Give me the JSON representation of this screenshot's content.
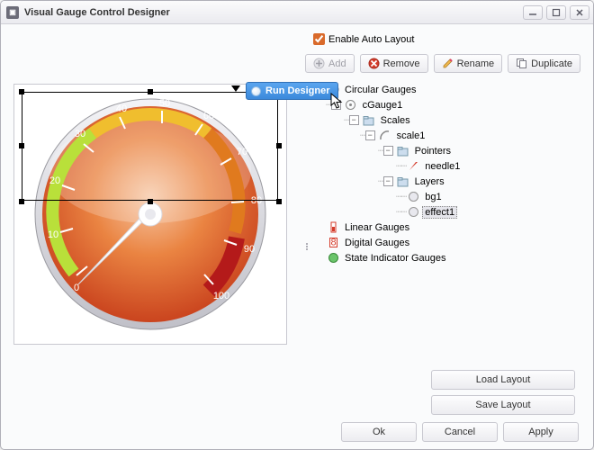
{
  "window": {
    "title": "Visual Gauge Control Designer",
    "minimize": "—",
    "maximize": "❐",
    "close": "✕"
  },
  "checkbox": {
    "label": "Enable Auto Layout",
    "checked": true
  },
  "toolbar": {
    "add": "Add",
    "remove": "Remove",
    "rename": "Rename",
    "duplicate": "Duplicate"
  },
  "context": {
    "run_designer": "Run Designer"
  },
  "tree": {
    "circular_gauges": "Circular Gauges",
    "cgauge1": "cGauge1",
    "scales": "Scales",
    "scale1": "scale1",
    "pointers": "Pointers",
    "needle1": "needle1",
    "layers": "Layers",
    "bg1": "bg1",
    "effect1": "effect1",
    "linear_gauges": "Linear Gauges",
    "digital_gauges": "Digital Gauges",
    "state_indicator_gauges": "State Indicator Gauges"
  },
  "layout_buttons": {
    "load": "Load Layout",
    "save": "Save Layout"
  },
  "footer": {
    "ok": "Ok",
    "cancel": "Cancel",
    "apply": "Apply"
  },
  "gauge": {
    "ticks": [
      "0",
      "10",
      "20",
      "30",
      "40",
      "50",
      "60",
      "70",
      "80",
      "90",
      "100"
    ]
  }
}
